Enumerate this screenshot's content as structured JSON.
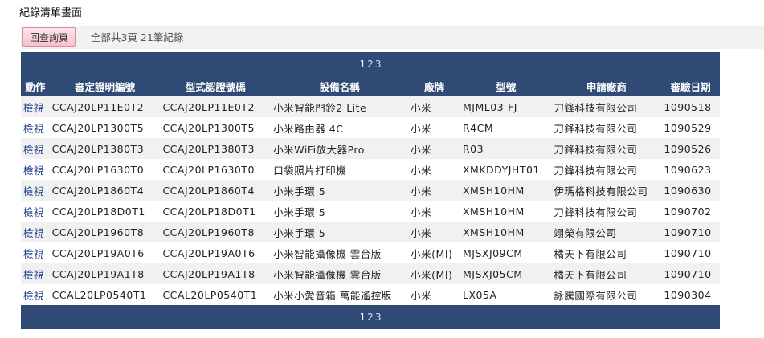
{
  "legend": "紀錄清單畫面",
  "toolbar": {
    "back_label": "回查詢頁",
    "summary": "全部共3頁 21筆紀錄"
  },
  "pager": {
    "pages": [
      "1",
      "2",
      "3"
    ],
    "current": "1"
  },
  "table": {
    "headers": [
      "動作",
      "審定證明編號",
      "型式認證號碼",
      "設備名稱",
      "廠牌",
      "型號",
      "申請廠商",
      "審驗日期"
    ],
    "rows": [
      [
        "檢視",
        "CCAJ20LP11E0T2",
        "CCAJ20LP11E0T2",
        "小米智能門鈴2 Lite",
        "小米",
        "MJML03-FJ",
        "刀鋒科技有限公司",
        "1090518"
      ],
      [
        "檢視",
        "CCAJ20LP1300T5",
        "CCAJ20LP1300T5",
        "小米路由器 4C",
        "小米",
        "R4CM",
        "刀鋒科技有限公司",
        "1090529"
      ],
      [
        "檢視",
        "CCAJ20LP1380T3",
        "CCAJ20LP1380T3",
        "小米WiFi放大器Pro",
        "小米",
        "R03",
        "刀鋒科技有限公司",
        "1090526"
      ],
      [
        "檢視",
        "CCAJ20LP1630T0",
        "CCAJ20LP1630T0",
        "口袋照片打印機",
        "小米",
        "XMKDDYJHT01",
        "刀鋒科技有限公司",
        "1090623"
      ],
      [
        "檢視",
        "CCAJ20LP1860T4",
        "CCAJ20LP1860T4",
        "小米手環 5",
        "小米",
        "XMSH10HM",
        "伊瑪格科技有限公司",
        "1090630"
      ],
      [
        "檢視",
        "CCAJ20LP18D0T1",
        "CCAJ20LP18D0T1",
        "小米手環 5",
        "小米",
        "XMSH10HM",
        "刀鋒科技有限公司",
        "1090702"
      ],
      [
        "檢視",
        "CCAJ20LP1960T8",
        "CCAJ20LP1960T8",
        "小米手環 5",
        "小米",
        "XMSH10HM",
        "翊榮有限公司",
        "1090710"
      ],
      [
        "檢視",
        "CCAJ20LP19A0T6",
        "CCAJ20LP19A0T6",
        "小米智能攝像機 雲台版",
        "小米(MI)",
        "MJSXJ09CM",
        "橘天下有限公司",
        "1090710"
      ],
      [
        "檢視",
        "CCAJ20LP19A1T8",
        "CCAJ20LP19A1T8",
        "小米智能攝像機 雲台版",
        "小米(MI)",
        "MJSXJ05CM",
        "橘天下有限公司",
        "1090710"
      ],
      [
        "檢視",
        "CCAL20LP0540T1",
        "CCAL20LP0540T1",
        "小米小愛音箱 萬能遙控版",
        "小米",
        "LX05A",
        "詠騰國際有限公司",
        "1090304"
      ]
    ]
  }
}
